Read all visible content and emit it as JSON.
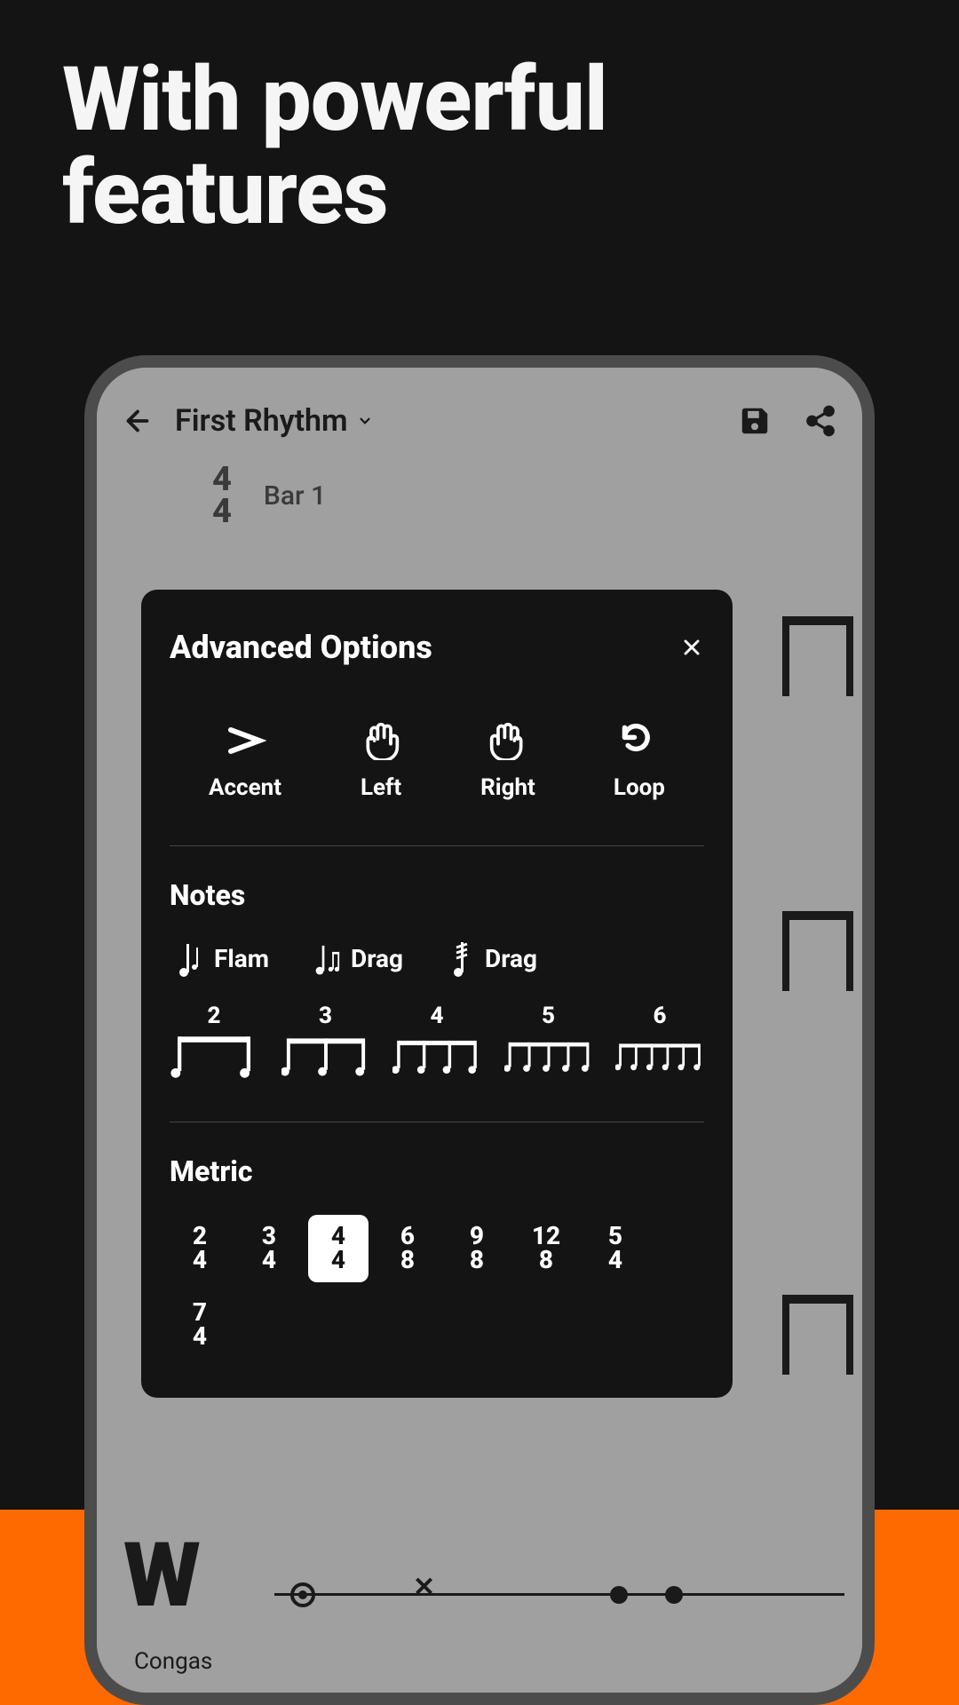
{
  "headline_line1": "With powerful",
  "headline_line2": "features",
  "header": {
    "title": "First Rhythm"
  },
  "timesig": {
    "top": "4",
    "bottom": "4"
  },
  "bar_label": "Bar 1",
  "instrument_label": "Congas",
  "modal": {
    "title": "Advanced Options",
    "actions": {
      "accent": "Accent",
      "left": "Left",
      "right": "Right",
      "loop": "Loop"
    },
    "notes_title": "Notes",
    "note_chips": {
      "flam": "Flam",
      "drag1": "Drag",
      "drag2": "Drag"
    },
    "tuplets": [
      "2",
      "3",
      "4",
      "5",
      "6"
    ],
    "metric_title": "Metric",
    "metrics": [
      {
        "top": "2",
        "bottom": "4",
        "selected": false
      },
      {
        "top": "3",
        "bottom": "4",
        "selected": false
      },
      {
        "top": "4",
        "bottom": "4",
        "selected": true
      },
      {
        "top": "6",
        "bottom": "8",
        "selected": false
      },
      {
        "top": "9",
        "bottom": "8",
        "selected": false
      },
      {
        "top": "12",
        "bottom": "8",
        "selected": false
      },
      {
        "top": "5",
        "bottom": "4",
        "selected": false
      },
      {
        "top": "7",
        "bottom": "4",
        "selected": false
      }
    ]
  }
}
